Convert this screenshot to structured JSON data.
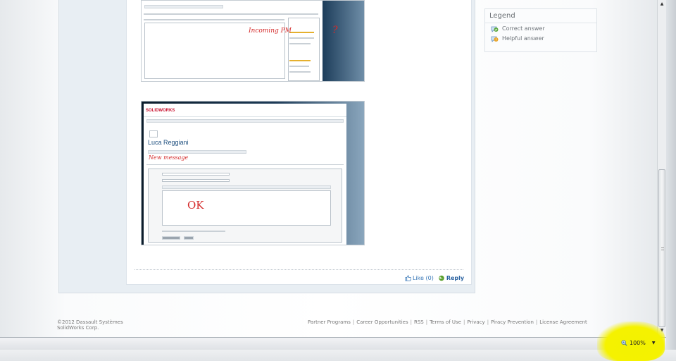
{
  "post": {
    "attachments": [
      {
        "alt": "Incoming PM screenshot",
        "annotation": "Incoming PM",
        "annotation_mark": "?"
      },
      {
        "alt": "New message screenshot",
        "annotation_title": "New message",
        "annotation_body": "OK",
        "mini_logo": "SOLIDWORKS",
        "mini_user": "Luca Reggiani"
      }
    ],
    "actions": {
      "like_label": "Like (0)",
      "reply_label": "Reply"
    }
  },
  "legend": {
    "title": "Legend",
    "items": [
      {
        "label": "Correct answer",
        "icon": "correct-answer-icon"
      },
      {
        "label": "Helpful answer",
        "icon": "helpful-answer-icon"
      }
    ]
  },
  "footer": {
    "copyright_line1": "©2012 Dassault Systèmes",
    "copyright_line2": "SolidWorks Corp.",
    "links": [
      "Partner Programs",
      "Career Opportunities",
      "RSS",
      "Terms of Use",
      "Privacy",
      "Piracy Prevention",
      "License Agreement"
    ]
  },
  "status_bar": {
    "zoom": "100%",
    "highlight_color": "#f5f200"
  }
}
